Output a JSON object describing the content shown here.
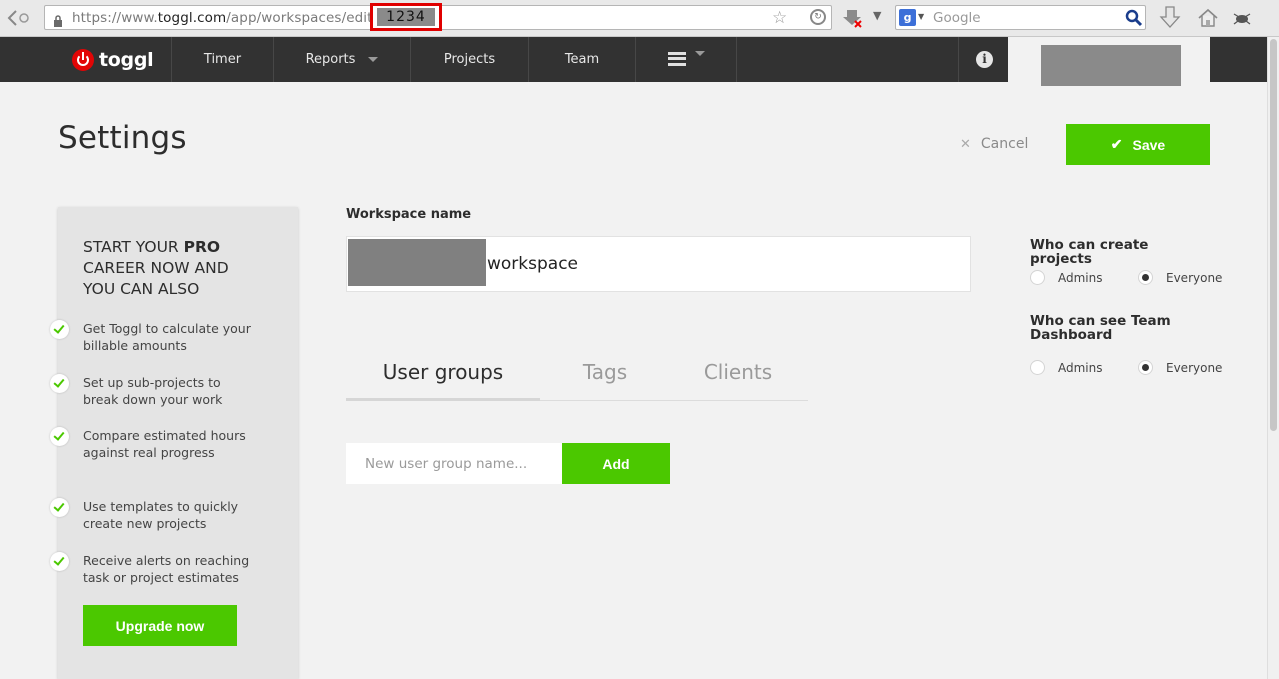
{
  "browser": {
    "url_prefix": "https://www.",
    "url_domain": "toggl.com",
    "url_path": "/app/workspaces/edit/",
    "url_id": "1234",
    "search_engine_letter": "g",
    "search_placeholder": "Google"
  },
  "nav": {
    "logo": "toggl",
    "items": [
      "Timer",
      "Reports",
      "Projects",
      "Team"
    ],
    "info_glyph": "i"
  },
  "page": {
    "title": "Settings",
    "cancel_label": "Cancel",
    "save_label": "Save"
  },
  "promo": {
    "heading_pre": "Start your ",
    "heading_bold": "Pro",
    "heading_post": " career now and you can also",
    "items": [
      "Get Toggl to calculate your billable amounts",
      "Set up sub-projects to break down your work",
      "Compare estimated hours against real progress",
      "Use templates to quickly create new projects",
      "Receive alerts on reaching task or project estimates"
    ],
    "upgrade_label": "Upgrade now"
  },
  "workspace": {
    "label": "Workspace name",
    "name_suffix": "workspace"
  },
  "tabs": {
    "items": [
      "User groups",
      "Tags",
      "Clients"
    ],
    "active": "User groups"
  },
  "user_groups": {
    "placeholder": "New user group name...",
    "add_label": "Add"
  },
  "permissions": {
    "create_projects": {
      "title": "Who can create projects",
      "options": [
        "Admins",
        "Everyone"
      ],
      "selected": "Everyone"
    },
    "team_dashboard": {
      "title": "Who can see Team Dashboard",
      "options": [
        "Admins",
        "Everyone"
      ],
      "selected": "Everyone"
    }
  },
  "colors": {
    "accent_green": "#4bc800",
    "nav_bg": "#323232",
    "logo_red": "#e20505",
    "highlight_red": "#e00000"
  }
}
